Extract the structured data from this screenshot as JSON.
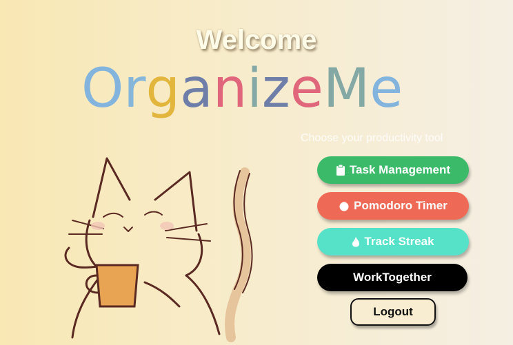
{
  "header": {
    "welcome": "Welcome",
    "logo_letters": [
      {
        "ch": "O",
        "color": "#82b4dd"
      },
      {
        "ch": "r",
        "color": "#86b6da"
      },
      {
        "ch": "g",
        "color": "#e2b53c"
      },
      {
        "ch": "a",
        "color": "#6e7ea8"
      },
      {
        "ch": "n",
        "color": "#e0677b"
      },
      {
        "ch": "i",
        "color": "#84a9a5"
      },
      {
        "ch": "z",
        "color": "#6e7ea8"
      },
      {
        "ch": "e",
        "color": "#e0677b"
      },
      {
        "ch": "M",
        "color": "#84a9a5"
      },
      {
        "ch": "e",
        "color": "#82b4dd"
      }
    ],
    "subtitle": "Choose your productivity tool"
  },
  "buttons": {
    "task": {
      "label": "Task Management",
      "icon": "clipboard-icon",
      "color": "#3bba69"
    },
    "pomodoro": {
      "label": "Pomodoro Timer",
      "icon": "tomato-icon",
      "color": "#ef6a56"
    },
    "streak": {
      "label": "Track Streak",
      "icon": "flame-icon",
      "color": "#55e2c8"
    },
    "worktogether": {
      "label": "WorkTogether",
      "color": "#000000"
    },
    "logout": {
      "label": "Logout"
    }
  },
  "illustration": {
    "icon": "cat-with-coffee-illustration"
  }
}
